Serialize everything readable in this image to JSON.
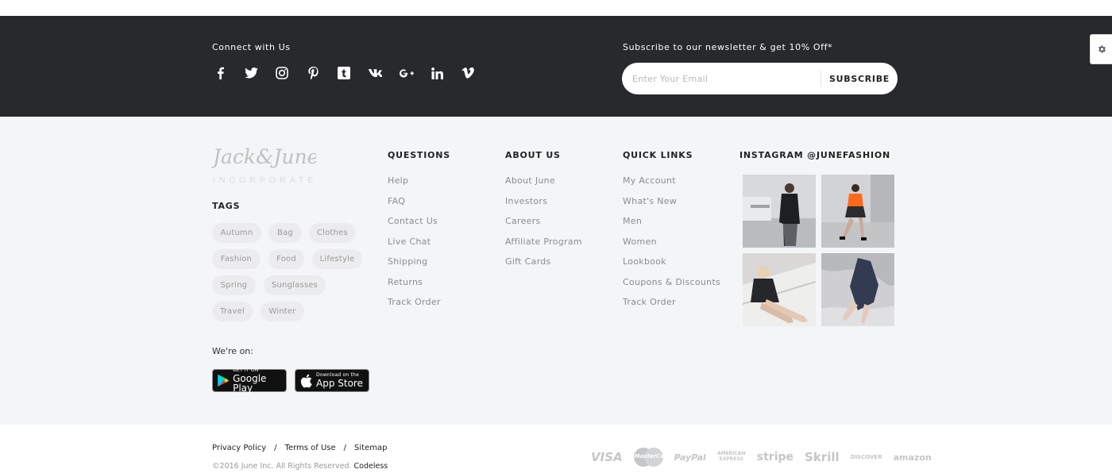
{
  "connect": {
    "title": "Connect with Us",
    "icons": [
      "facebook-icon",
      "twitter-icon",
      "instagram-icon",
      "pinterest-icon",
      "tumblr-icon",
      "vk-icon",
      "google-plus-icon",
      "linkedin-icon",
      "vimeo-icon"
    ]
  },
  "newsletter": {
    "title": "Subscribe to our newsletter & get 10% Off*",
    "placeholder": "Enter Your Email",
    "button_label": "SUBSCRIBE"
  },
  "brand": {
    "logo_text": "Jack&June",
    "logo_sub": "INCORPORATED"
  },
  "tags": {
    "title": "TAGS",
    "items": [
      "Autumn",
      "Bag",
      "Clothes",
      "Fashion",
      "Food",
      "Lifestyle",
      "Spring",
      "Sunglasses",
      "Travel",
      "Winter"
    ]
  },
  "stores": {
    "title": "We're on:",
    "google_small": "GET IT ON",
    "google_big": "Google Play",
    "apple_small": "Download on the",
    "apple_big": "App Store"
  },
  "columns": {
    "questions": {
      "title": "QUESTIONS",
      "items": [
        "Help",
        "FAQ",
        "Contact Us",
        "Live Chat",
        "Shipping",
        "Returns",
        "Track Order"
      ]
    },
    "about": {
      "title": "ABOUT US",
      "items": [
        "About June",
        "Investors",
        "Careers",
        "Affiliate Program",
        "Gift Cards"
      ]
    },
    "quick": {
      "title": "QUICK LINKS",
      "items": [
        "My Account",
        "What's New",
        "Men",
        "Women",
        "Lookbook",
        "Coupons & Discounts",
        "Track Order"
      ]
    },
    "instagram": {
      "title": "INSTAGRAM @JUNEFASHION"
    }
  },
  "bottom": {
    "privacy": "Privacy Policy",
    "sep": "/",
    "terms": "Terms of Use",
    "sitemap": "Sitemap",
    "copyright": "©2016 June Inc. All Rights Reserved.",
    "credit": "Codeless"
  },
  "payments": [
    "VISA",
    "MasterCard",
    "PayPal",
    "AMERICAN EXPRESS",
    "stripe",
    "Skrill",
    "DISCOVER",
    "amazon"
  ],
  "colors": {
    "dark_bar": "#27292d",
    "light_area": "#f4f5f7",
    "tag_bg": "#ececee",
    "link": "#8c8c8c"
  }
}
